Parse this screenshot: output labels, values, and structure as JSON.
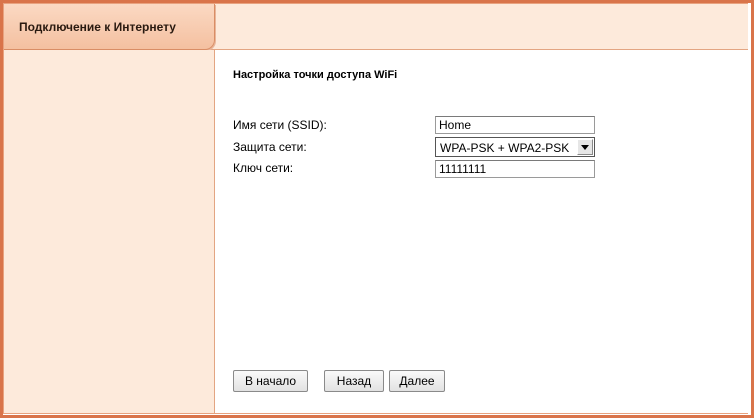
{
  "header": {
    "tab_label": "Подключение к Интернету"
  },
  "form": {
    "title": "Настройка точки доступа WiFi",
    "ssid_label": "Имя сети (SSID):",
    "ssid_value": "Home",
    "security_label": "Защита сети:",
    "security_value": "WPA-PSK + WPA2-PSK",
    "key_label": "Ключ сети:",
    "key_value": "11111111"
  },
  "buttons": {
    "home": "В начало",
    "back": "Назад",
    "next": "Далее"
  },
  "colors": {
    "accent_border": "#d9744a",
    "panel_bg": "#fdeadb",
    "tab_bg": "#f4c0a0"
  }
}
